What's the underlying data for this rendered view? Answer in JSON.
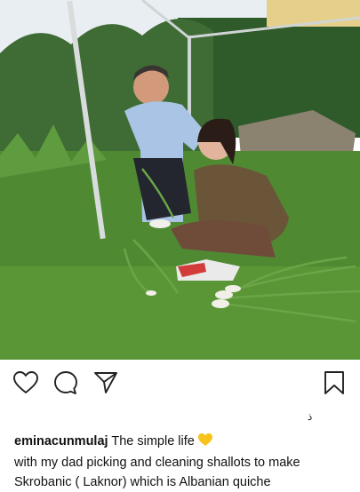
{
  "post": {
    "photo_icon": "post-photo",
    "actions": {
      "like_icon": "heart-icon",
      "comment_icon": "comment-icon",
      "share_icon": "send-icon",
      "save_icon": "bookmark-icon"
    },
    "small_mark": "ذ",
    "caption": {
      "username": "eminacunmulaj",
      "text_line1": "The simple life",
      "emoji": "yellow-heart-emoji",
      "text_line2": "with my dad picking and cleaning shallots to make",
      "text_line3": "Skrobanic ( Laknor) which is Albanian quiche"
    }
  },
  "colors": {
    "emoji_yellow": "#f7c21a",
    "icon_stroke": "#222222",
    "grass": "#4f8a33",
    "sky": "#e9eef2"
  }
}
